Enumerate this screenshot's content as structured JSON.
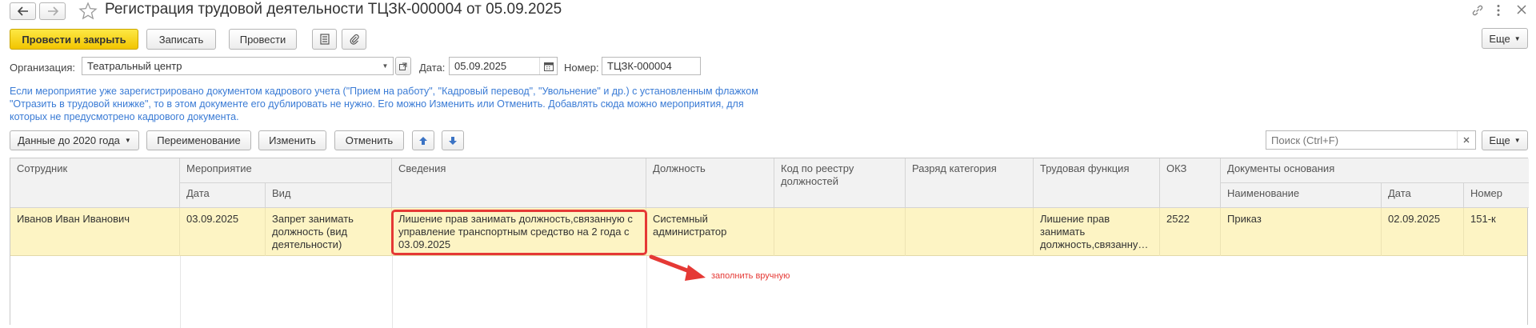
{
  "window": {
    "title": "Регистрация трудовой деятельности ТЦЗК-000004 от 05.09.2025"
  },
  "toolbar": {
    "post_close_label": "Провести и закрыть",
    "save_label": "Записать",
    "post_label": "Провести",
    "more_label": "Еще"
  },
  "header_fields": {
    "org_label": "Организация:",
    "org_value": "Театральный центр",
    "date_label": "Дата:",
    "date_value": "05.09.2025",
    "number_label": "Номер:",
    "number_value": "ТЦЗК-000004"
  },
  "info_text": {
    "line1": "Если мероприятие уже зарегистрировано документом кадрового учета (\"Прием на работу\", \"Кадровый перевод\", \"Увольнение\" и др.) с установленным флажком",
    "line2": "\"Отразить в трудовой книжке\", то в этом документе его дублировать не нужно. Его можно Изменить или Отменить. Добавлять сюда можно мероприятия, для",
    "line3": "которых не предусмотрено кадрового документа."
  },
  "table_toolbar": {
    "data_before_label": "Данные до 2020 года",
    "rename_label": "Переименование",
    "change_label": "Изменить",
    "cancel_label": "Отменить",
    "search_placeholder": "Поиск (Ctrl+F)",
    "more_label": "Еще"
  },
  "table": {
    "headers": {
      "employee": "Сотрудник",
      "event": "Мероприятие",
      "event_date": "Дата",
      "event_kind": "Вид",
      "details": "Сведения",
      "position": "Должность",
      "registry_code": "Код по реестру должностей",
      "grade": "Разряд категория",
      "labor_function": "Трудовая функция",
      "okz": "ОКЗ",
      "docs": "Документы основания",
      "doc_name": "Наименование",
      "doc_date": "Дата",
      "doc_number": "Номер"
    },
    "rows": [
      {
        "employee": "Иванов Иван Иванович",
        "event_date": "03.09.2025",
        "event_kind": "Запрет занимать должность (вид деятельности)",
        "details": "Лишение прав занимать должность,связанную с управление транспортным средство на 2 года с 03.09.2025",
        "position": "Системный администратор",
        "registry_code": "",
        "grade": "",
        "labor_function": "Лишение прав занимать должность,связанну…",
        "okz": "2522",
        "doc_name": "Приказ",
        "doc_date": "02.09.2025",
        "doc_number": "151-к"
      }
    ]
  },
  "annotation": {
    "text": "заполнить вручную",
    "color": "#e53935"
  },
  "colors": {
    "primary_button": "#f5d21a",
    "info_text": "#3a7bd5",
    "selected_row": "#fdf4c4",
    "highlight": "#e53935"
  }
}
